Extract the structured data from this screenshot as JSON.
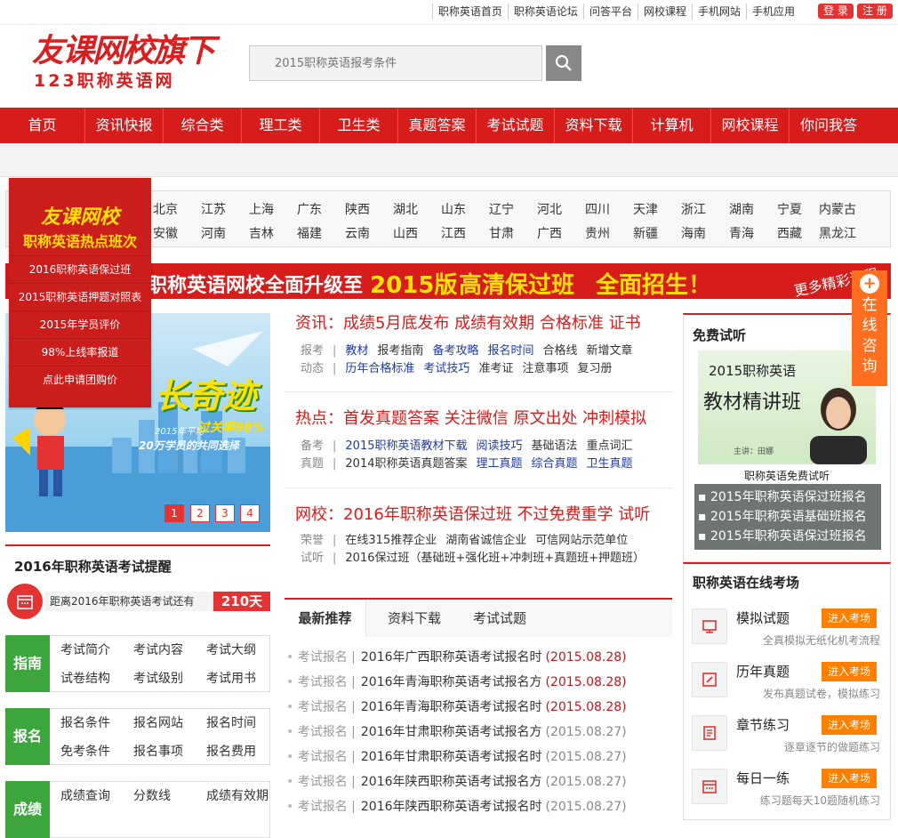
{
  "top": {
    "links": [
      "职称英语首页",
      "职称英语论坛",
      "问答平台",
      "网校课程",
      "手机网站",
      "手机应用"
    ],
    "login": "登 录",
    "register": "注 册"
  },
  "logo": {
    "line1": "友课网校旗下",
    "line2": "123职称英语网"
  },
  "search": {
    "placeholder": "2015职称英语报考条件"
  },
  "nav": [
    "首页",
    "资讯快报",
    "综合类",
    "理工类",
    "卫生类",
    "真题答案",
    "考试试题",
    "资料下载",
    "计算机",
    "网校课程",
    "你问我答"
  ],
  "regions": {
    "row1": [
      "北京",
      "江苏",
      "上海",
      "广东",
      "陕西",
      "湖北",
      "山东",
      "辽宁",
      "河北",
      "四川",
      "天津",
      "浙江",
      "湖南",
      "宁夏",
      "内蒙古"
    ],
    "row2": [
      "安徽",
      "河南",
      "吉林",
      "福建",
      "云南",
      "山西",
      "江西",
      "甘肃",
      "广西",
      "贵州",
      "新疆",
      "海南",
      "青海",
      "西藏",
      "黑龙江"
    ]
  },
  "banner": {
    "part1": "职称英语网校全面升级至",
    "part2": "2015版",
    "part3": "高清保过班",
    "part4": "全面招生！",
    "more": "更多精彩课程"
  },
  "popup": {
    "title1": "友课网校",
    "title2": "职称英语热点班次",
    "items": [
      "2016职称英语保过班",
      "2015职称英语押题对照表",
      "2015年学员评价",
      "98%上线率报道",
      "点此申请团购价"
    ]
  },
  "slider": {
    "text1": "长奇迹",
    "text2": "2015年平均",
    "text3": "过关率98%",
    "text4": "20万学员的共同选择",
    "dots": [
      "1",
      "2",
      "3",
      "4"
    ]
  },
  "news": {
    "s1": {
      "head": "资讯：成绩5月底发布 成绩有效期 合格标准 证书",
      "r1": {
        "label": "报考",
        "items": [
          "教材",
          "报考指南",
          "备考攻略",
          "报名时间",
          "合格线",
          "新增文章"
        ]
      },
      "r2": {
        "label": "动态",
        "items": [
          "历年合格标准",
          "考试技巧",
          "准考证",
          "注意事项",
          "复习册"
        ]
      }
    },
    "s2": {
      "head": "热点：首发真题答案 关注微信 原文出处 冲刺模拟",
      "r1": {
        "label": "备考",
        "items": [
          "2015职称英语教材下载",
          "阅读技巧",
          "基础语法",
          "重点词汇"
        ]
      },
      "r2": {
        "label": "真题",
        "items": [
          "2014职称英语真题答案",
          "理工真题",
          "综合真题",
          "卫生真题"
        ]
      }
    },
    "s3": {
      "head": "网校：2016年职称英语保过班 不过免费重学 试听",
      "r1": {
        "label": "荣誉",
        "items": [
          "在线315推荐企业",
          "湖南省诚信企业",
          "可信网站示范单位"
        ]
      },
      "r2": {
        "label": "试听",
        "items": [
          "2016保过班（基础班+强化班+冲刺班+真题班+押题班）"
        ]
      }
    }
  },
  "remind": {
    "title": "2016年职称英语考试提醒",
    "countdown_label": "距离2016年职称英语考试还有",
    "days": "210天"
  },
  "guide": {
    "b1": {
      "head": "指南",
      "items": [
        "考试简介",
        "考试内容",
        "考试大纲",
        "试卷结构",
        "考试级别",
        "考试用书"
      ]
    },
    "b2": {
      "head": "报名",
      "items": [
        "报名条件",
        "报名网站",
        "报名时间",
        "免考条件",
        "报名事项",
        "报名费用"
      ]
    },
    "b3": {
      "head": "成绩",
      "items": [
        "成绩查询",
        "分数线",
        "成绩有效期"
      ]
    }
  },
  "tabs": [
    "最新推荐",
    "资料下载",
    "考试试题"
  ],
  "list": [
    {
      "cat": "考试报名 |",
      "title": "2016年广西职称英语考试报名时",
      "date": "(2015.08.28)",
      "hot": true
    },
    {
      "cat": "考试报名 |",
      "title": "2016年青海职称英语考试报名方",
      "date": "(2015.08.28)",
      "hot": true
    },
    {
      "cat": "考试报名 |",
      "title": "2016年青海职称英语考试报名时",
      "date": "(2015.08.28)",
      "hot": true
    },
    {
      "cat": "考试报名 |",
      "title": "2016年甘肃职称英语考试报名方",
      "date": "(2015.08.27)",
      "hot": false
    },
    {
      "cat": "考试报名 |",
      "title": "2016年甘肃职称英语考试报名时",
      "date": "(2015.08.27)",
      "hot": false
    },
    {
      "cat": "考试报名 |",
      "title": "2016年陕西职称英语考试报名方",
      "date": "(2015.08.27)",
      "hot": false
    },
    {
      "cat": "考试报名 |",
      "title": "2016年陕西职称英语考试报名时",
      "date": "(2015.08.27)",
      "hot": false
    }
  ],
  "free": {
    "title": "免费试听",
    "video_t1": "2015职称英语",
    "video_t2": "教材精讲班",
    "teacher": "主讲：田娜",
    "caption": "职称英语免费试听",
    "links": [
      "2015年职称英语保过班报名",
      "2015年职称英语基础班报名",
      "2015年职称英语保过班报名"
    ]
  },
  "exam": {
    "title": "职称英语在线考场",
    "btn": "进入考场",
    "items": [
      {
        "title": "模拟试题",
        "desc": "全真模拟无纸化机考流程",
        "icon": "monitor-icon"
      },
      {
        "title": "历年真题",
        "desc": "发布真题试卷，模拟练习",
        "icon": "edit-icon"
      },
      {
        "title": "章节练习",
        "desc": "逐章逐节的做题练习",
        "icon": "book-icon"
      },
      {
        "title": "每日一练",
        "desc": "练习题每天10题随机练习",
        "icon": "calendar-icon"
      }
    ]
  },
  "consult": {
    "plus": "+",
    "text": [
      "在",
      "线",
      "咨",
      "询"
    ]
  }
}
